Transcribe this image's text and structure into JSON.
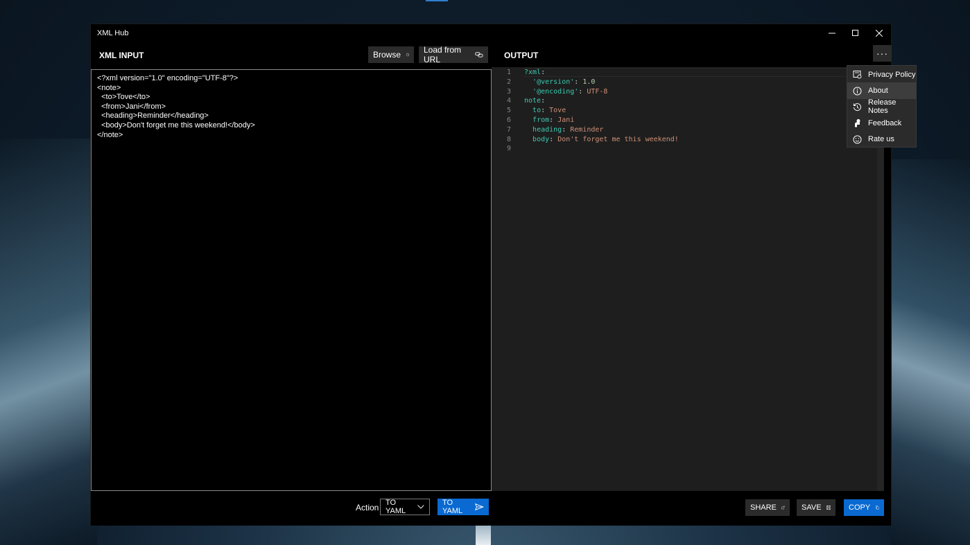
{
  "window": {
    "title": "XML Hub"
  },
  "input": {
    "header": "XML INPUT",
    "browse_label": "Browse",
    "load_url_label": "Load from URL",
    "lines": [
      "<?xml version=\"1.0\" encoding=\"UTF-8\"?>",
      "<note>",
      "  <to>Tove</to>",
      "  <from>Jani</from>",
      "  <heading>Reminder</heading>",
      "  <body>Don't forget me this weekend!</body>",
      "</note>"
    ]
  },
  "output": {
    "header": "OUTPUT",
    "lines": [
      {
        "n": "1",
        "indent": "",
        "key": "?xml",
        "sep": ":",
        "value": "",
        "value_type": ""
      },
      {
        "n": "2",
        "indent": "  ",
        "key": "'@version'",
        "sep": ": ",
        "value": "1.0",
        "value_type": "num"
      },
      {
        "n": "3",
        "indent": "  ",
        "key": "'@encoding'",
        "sep": ": ",
        "value": "UTF-8",
        "value_type": "str"
      },
      {
        "n": "4",
        "indent": "",
        "key": "note",
        "sep": ":",
        "value": "",
        "value_type": ""
      },
      {
        "n": "5",
        "indent": "  ",
        "key": "to",
        "sep": ": ",
        "value": "Tove",
        "value_type": "str"
      },
      {
        "n": "6",
        "indent": "  ",
        "key": "from",
        "sep": ": ",
        "value": "Jani",
        "value_type": "str"
      },
      {
        "n": "7",
        "indent": "  ",
        "key": "heading",
        "sep": ": ",
        "value": "Reminder",
        "value_type": "str"
      },
      {
        "n": "8",
        "indent": "  ",
        "key": "body",
        "sep": ": ",
        "value": "Don't forget me this weekend!",
        "value_type": "str"
      },
      {
        "n": "9",
        "indent": "",
        "key": "",
        "sep": "",
        "value": "",
        "value_type": ""
      }
    ]
  },
  "menu": {
    "items": [
      {
        "label": "Privacy Policy",
        "icon": "privacy-icon",
        "highlighted": false
      },
      {
        "label": "About",
        "icon": "info-icon",
        "highlighted": true
      },
      {
        "label": "Release Notes",
        "icon": "history-icon",
        "highlighted": false
      },
      {
        "label": "Feedback",
        "icon": "feedback-icon",
        "highlighted": false
      },
      {
        "label": "Rate us",
        "icon": "smiley-icon",
        "highlighted": false
      }
    ]
  },
  "bottom": {
    "action_label": "Action",
    "action_value": "TO YAML",
    "convert_label": "TO YAML",
    "share_label": "SHARE",
    "save_label": "SAVE",
    "copy_label": "COPY"
  },
  "colors": {
    "accent": "#0a6ad1",
    "yaml_key": "#3dc9b0",
    "yaml_string": "#ce9178",
    "yaml_number": "#b5cea8",
    "editor_bg": "#1e1e1e"
  }
}
